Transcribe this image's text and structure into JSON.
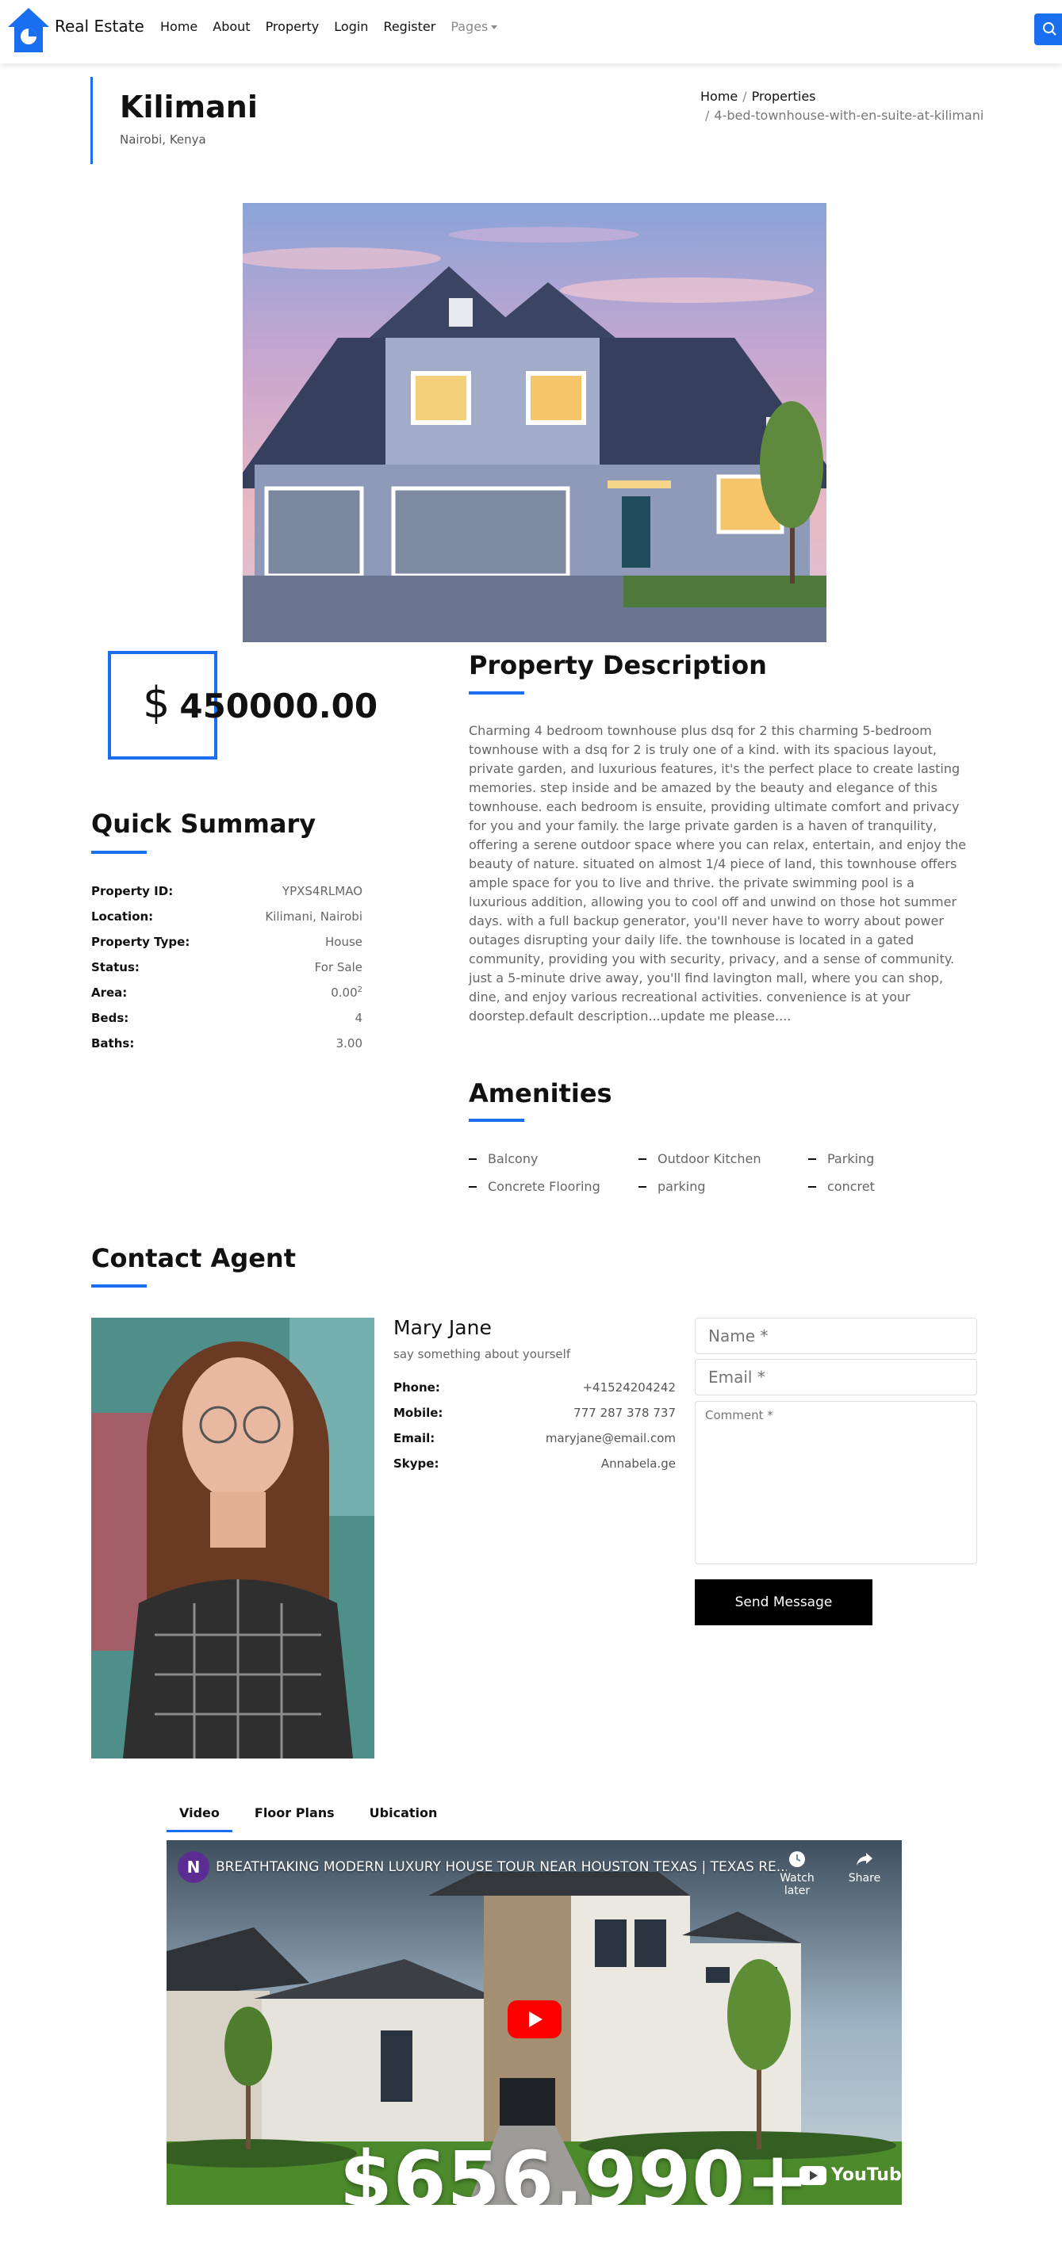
{
  "navbar": {
    "brand": "Real Estate",
    "links": [
      "Home",
      "About",
      "Property",
      "Login",
      "Register"
    ],
    "pages_label": "Pages",
    "search_icon": "search-icon",
    "accent": "#1a6ef0"
  },
  "header": {
    "title": "Kilimani",
    "location": "Nairobi, Kenya",
    "breadcrumb": {
      "home": "Home",
      "properties": "Properties",
      "current": "4-bed-townhouse-with-en-suite-at-kilimani"
    }
  },
  "price": {
    "currency": "$",
    "amount": "450000.00"
  },
  "summary": {
    "title": "Quick Summary",
    "rows": [
      {
        "label": "Property ID:",
        "value": "YPXS4RLMAO"
      },
      {
        "label": "Location:",
        "value": "Kilimani, Nairobi"
      },
      {
        "label": "Property Type:",
        "value": "House"
      },
      {
        "label": "Status:",
        "value": "For Sale"
      },
      {
        "label": "Area:",
        "value": "0.00",
        "sup": "2"
      },
      {
        "label": "Beds:",
        "value": "4"
      },
      {
        "label": "Baths:",
        "value": "3.00"
      }
    ]
  },
  "description": {
    "title": "Property Description",
    "text": "Charming 4 bedroom townhouse plus dsq for 2 this charming 5-bedroom townhouse with a dsq for 2 is truly one of a kind. with its spacious layout, private garden, and luxurious features, it's the perfect place to create lasting memories. step inside and be amazed by the beauty and elegance of this townhouse. each bedroom is ensuite, providing ultimate comfort and privacy for you and your family. the large private garden is a haven of tranquility, offering a serene outdoor space where you can relax, entertain, and enjoy the beauty of nature. situated on almost 1/4 piece of land, this townhouse offers ample space for you to live and thrive. the private swimming pool is a luxurious addition, allowing you to cool off and unwind on those hot summer days. with a full backup generator, you'll never have to worry about power outages disrupting your daily life. the townhouse is located in a gated community, providing you with security, privacy, and a sense of community. just a 5-minute drive away, you'll find lavington mall, where you can shop, dine, and enjoy various recreational activities. convenience is at your doorstep.default description...update me please...."
  },
  "amenities": {
    "title": "Amenities",
    "items": [
      "Balcony",
      "Outdoor Kitchen",
      "Parking",
      "Concrete Flooring",
      "parking",
      "concret"
    ]
  },
  "agent": {
    "section_title": "Contact Agent",
    "name": "Mary Jane",
    "about": "say something about yourself",
    "rows": [
      {
        "label": "Phone:",
        "value": "+41524204242"
      },
      {
        "label": "Mobile:",
        "value": "777 287 378 737"
      },
      {
        "label": "Email:",
        "value": "maryjane@email.com"
      },
      {
        "label": "Skype:",
        "value": "Annabela.ge"
      }
    ]
  },
  "contact_form": {
    "name_placeholder": "Name *",
    "email_placeholder": "Email *",
    "comment_placeholder": "Comment *",
    "send_label": "Send Message"
  },
  "tabs": [
    "Video",
    "Floor Plans",
    "Ubication"
  ],
  "video": {
    "channel_initial": "N",
    "title": "BREATHTAKING MODERN LUXURY HOUSE TOUR NEAR HOUSTON TEXAS | TEXAS RE...",
    "watch_later": "Watch later",
    "share": "Share",
    "overlay_price": "$656,990+",
    "youtube_label": "YouTube"
  }
}
